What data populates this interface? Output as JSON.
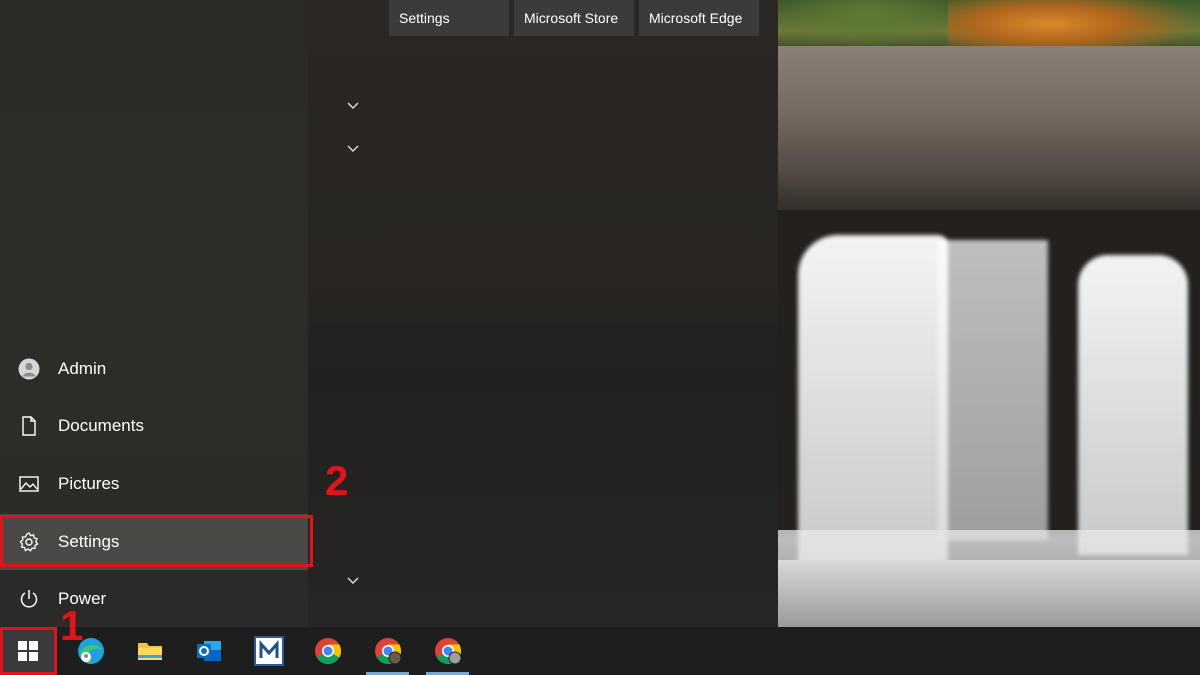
{
  "tiles": [
    {
      "label": "Settings"
    },
    {
      "label": "Microsoft Store"
    },
    {
      "label": "Microsoft Edge"
    }
  ],
  "start_menu_items": [
    {
      "label": "Admin",
      "icon": "user-icon"
    },
    {
      "label": "Documents",
      "icon": "document-icon"
    },
    {
      "label": "Pictures",
      "icon": "pictures-icon"
    },
    {
      "label": "Settings",
      "icon": "gear-icon"
    },
    {
      "label": "Power",
      "icon": "power-icon"
    }
  ],
  "annotations": {
    "step1": "1",
    "step2": "2"
  },
  "taskbar": {
    "items": [
      {
        "name": "windows-start",
        "icon": "windows-logo-icon"
      },
      {
        "name": "microsoft-edge",
        "icon": "edge-icon"
      },
      {
        "name": "file-explorer",
        "icon": "folder-icon"
      },
      {
        "name": "outlook",
        "icon": "outlook-icon"
      },
      {
        "name": "m-app",
        "icon": "m-app-icon"
      },
      {
        "name": "chrome",
        "icon": "chrome-icon"
      },
      {
        "name": "chrome-profile-1",
        "icon": "chrome-profile-icon",
        "running": true
      },
      {
        "name": "chrome-profile-2",
        "icon": "chrome-profile-icon",
        "running": true
      }
    ]
  },
  "colors": {
    "highlight": "#e0141a",
    "accent": "#7aa7d8"
  }
}
